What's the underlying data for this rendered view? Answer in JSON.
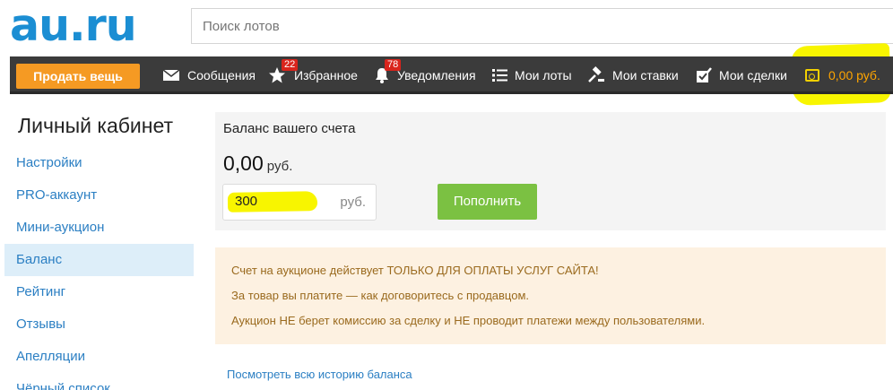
{
  "header": {
    "logo": "au.ru",
    "search_placeholder": "Поиск лотов"
  },
  "navbar": {
    "sell_button": "Продать вещь",
    "items": [
      {
        "label": "Сообщения",
        "icon": "envelope-icon"
      },
      {
        "label": "Избранное",
        "icon": "star-icon",
        "badge": "22"
      },
      {
        "label": "Уведомления",
        "icon": "bell-icon",
        "badge": "78"
      },
      {
        "label": "Мои лоты",
        "icon": "list-icon"
      },
      {
        "label": "Мои ставки",
        "icon": "gavel-icon"
      },
      {
        "label": "Мои сделки",
        "icon": "checkbox-icon"
      }
    ],
    "balance": "0,00 руб.",
    "balance_icon": "wallet-icon"
  },
  "sidebar": {
    "title": "Личный кабинет",
    "items": [
      {
        "label": "Настройки"
      },
      {
        "label": "PRO-аккаунт"
      },
      {
        "label": "Мини-аукцион"
      },
      {
        "label": "Баланс",
        "active": true
      },
      {
        "label": "Рейтинг"
      },
      {
        "label": "Отзывы"
      },
      {
        "label": "Апелляции"
      },
      {
        "label": "Чёрный список"
      }
    ]
  },
  "balance_panel": {
    "title": "Баланс вашего счета",
    "amount": "0,00",
    "currency": "руб.",
    "input_value": "300",
    "input_unit": "руб.",
    "topup_button": "Пополнить"
  },
  "notice": {
    "lines": [
      "Счет на аукционе действует ТОЛЬКО ДЛЯ ОПЛАТЫ УСЛУГ САЙТА!",
      "За товар вы платите — как договоритесь с продавцом.",
      "Аукцион НЕ берет комиссию за сделку и НЕ проводит платежи между пользователями."
    ]
  },
  "history_link": "Посмотреть всю историю баланса",
  "colors": {
    "brand": "#1b8ed3",
    "navbar_bg": "#3b3b3b",
    "sell_button": "#f59a23",
    "topup_button": "#7bc142",
    "badge": "#d9241c",
    "highlight": "#f8f500",
    "notice_bg": "#fdf1e1",
    "link": "#2b7fc3"
  }
}
